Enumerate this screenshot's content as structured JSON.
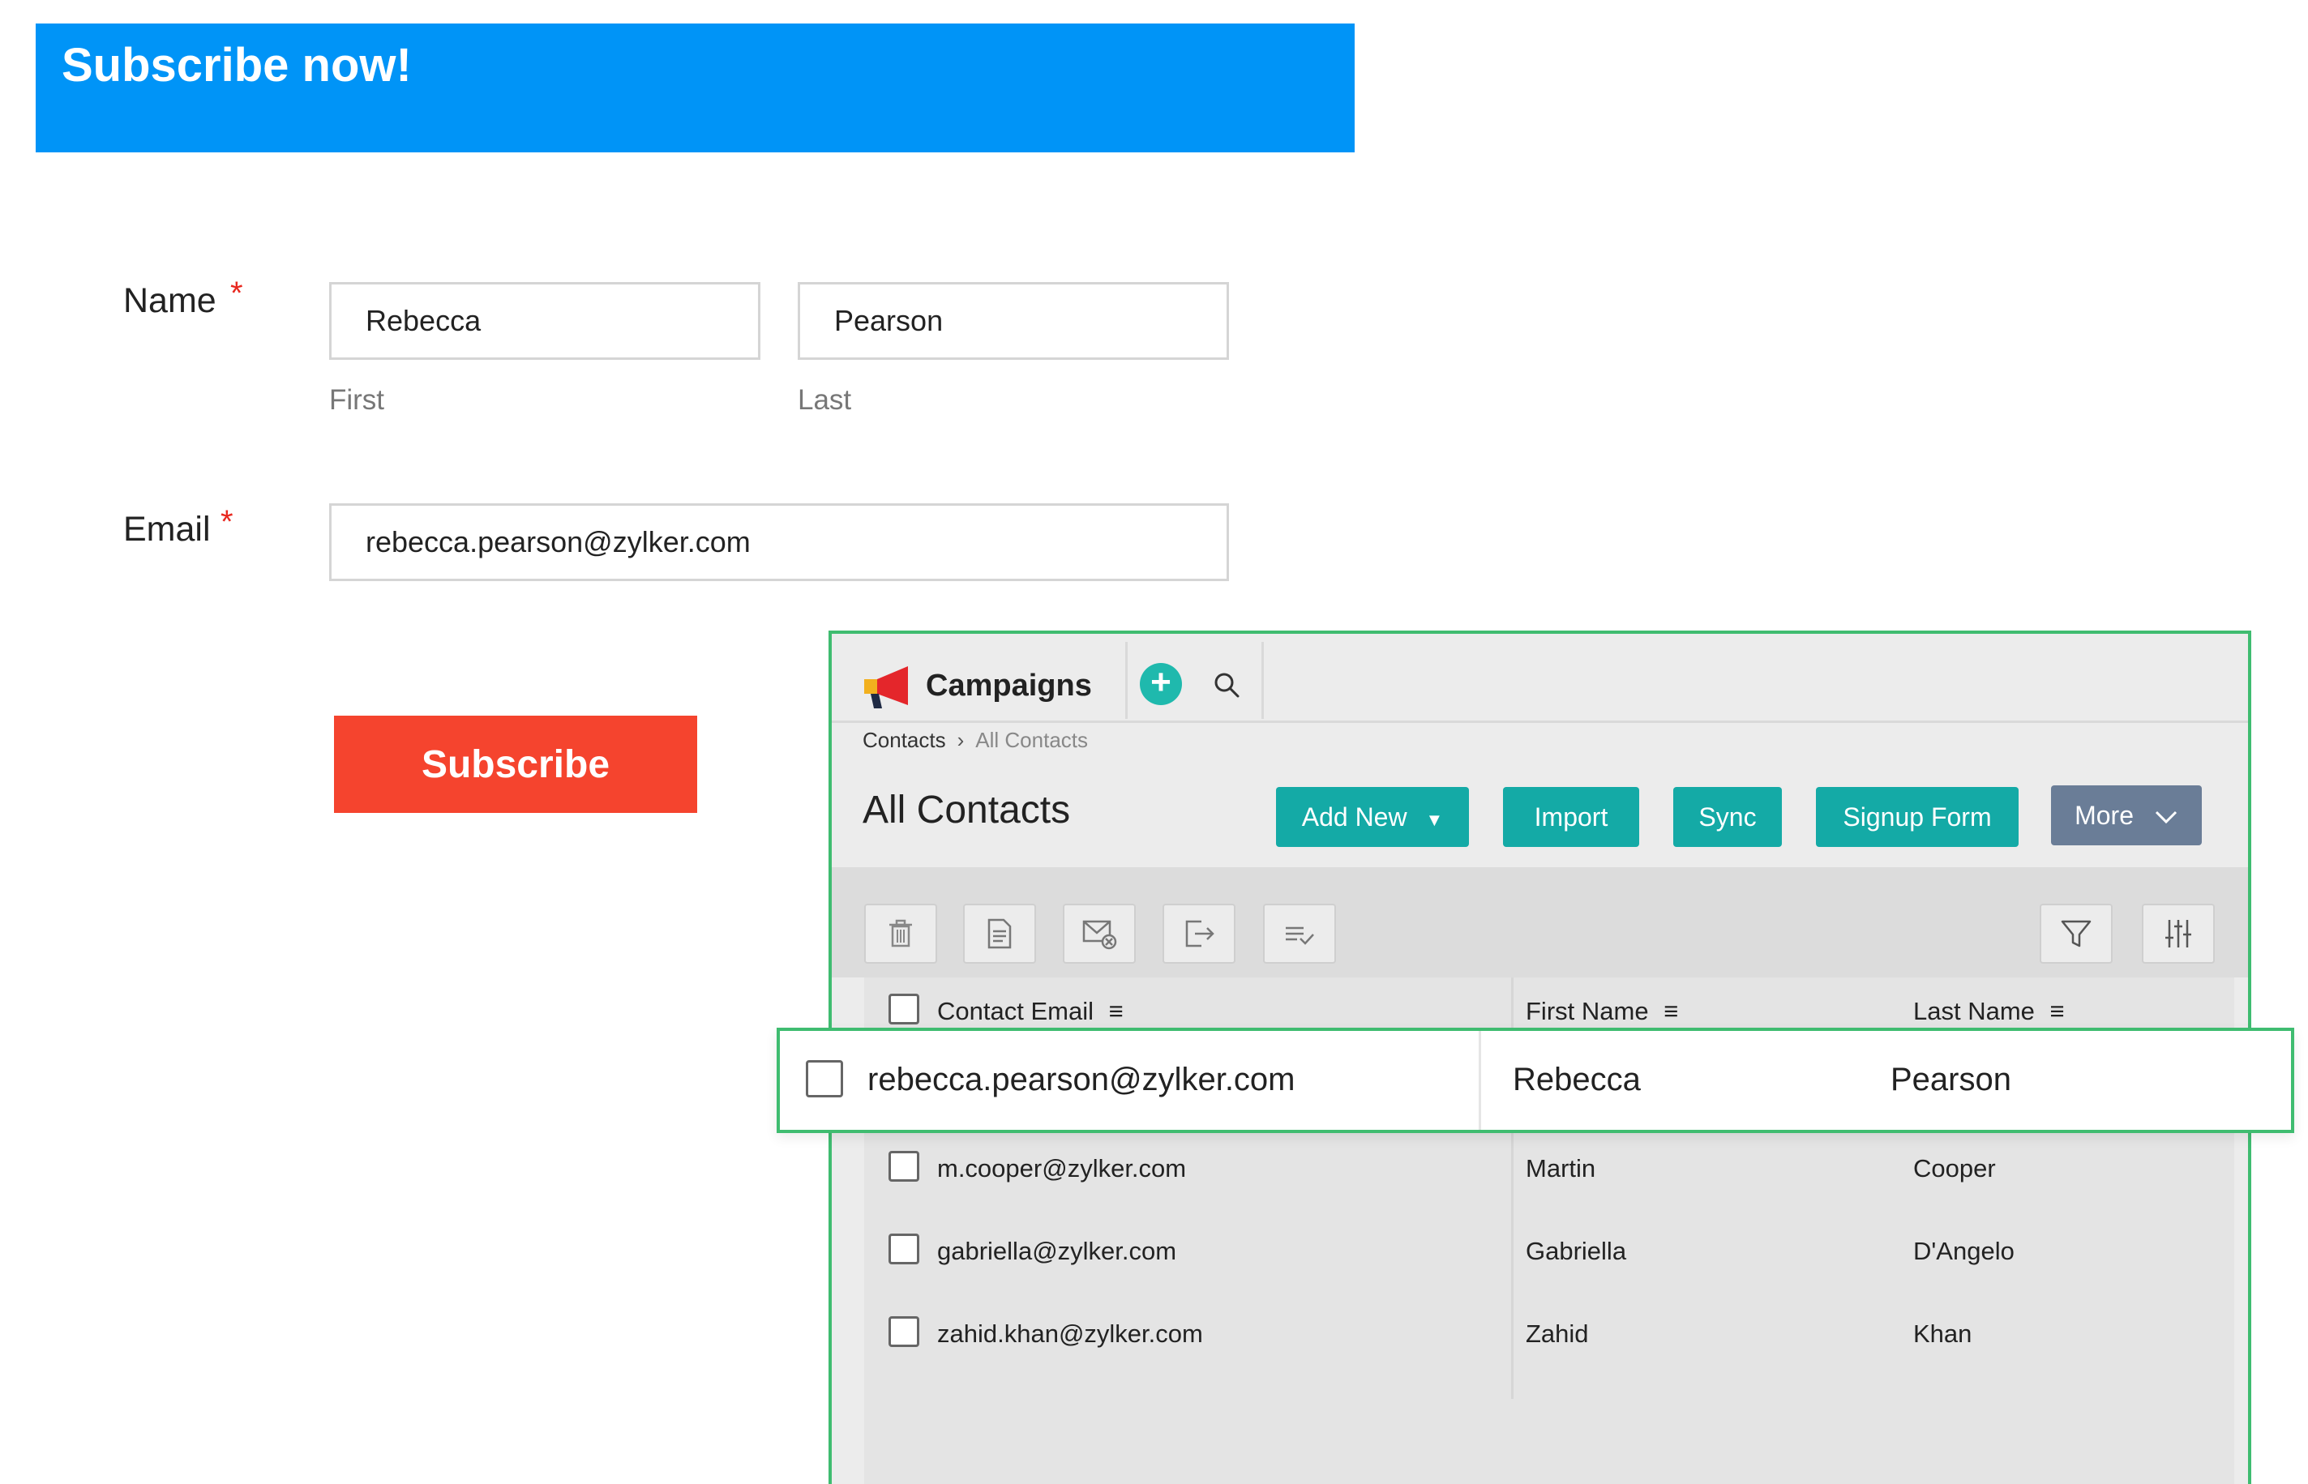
{
  "form": {
    "banner_title": "Subscribe now!",
    "name_label": "Name",
    "required_mark": "*",
    "first_name_value": "Rebecca",
    "last_name_value": "Pearson",
    "first_sublabel": "First",
    "last_sublabel": "Last",
    "email_label": "Email",
    "email_value": "rebecca.pearson@zylker.com",
    "subscribe_label": "Subscribe",
    "colors": {
      "banner": "#0094f7",
      "subscribe_button": "#f5442e",
      "required": "#e8271e"
    }
  },
  "app": {
    "name": "Campaigns",
    "add_icon": "plus-circle-icon",
    "search_icon": "search-icon",
    "breadcrumb": {
      "parent": "Contacts",
      "separator": "›",
      "current": "All Contacts"
    },
    "page_title": "All Contacts",
    "actions": {
      "add_new": "Add New",
      "import": "Import",
      "sync": "Sync",
      "signup_form": "Signup Form",
      "more": "More"
    },
    "toolbar_icons": [
      "trash-icon",
      "document-icon",
      "mail-unsubscribe-icon",
      "export-icon",
      "list-check-icon",
      "filter-icon",
      "column-settings-icon"
    ],
    "table": {
      "columns": [
        "Contact Email",
        "First Name",
        "Last Name"
      ],
      "highlighted_row": {
        "email": "rebecca.pearson@zylker.com",
        "first": "Rebecca",
        "last": "Pearson"
      },
      "rows": [
        {
          "email": "m.cooper@zylker.com",
          "first": "Martin",
          "last": "Cooper"
        },
        {
          "email": "gabriella@zylker.com",
          "first": "Gabriella",
          "last": "D'Angelo"
        },
        {
          "email": "zahid.khan@zylker.com",
          "first": "Zahid",
          "last": "Khan"
        }
      ]
    },
    "colors": {
      "accent": "#14aaa6",
      "more_button": "#6a7d97",
      "highlight_border": "#3fbc70"
    }
  }
}
